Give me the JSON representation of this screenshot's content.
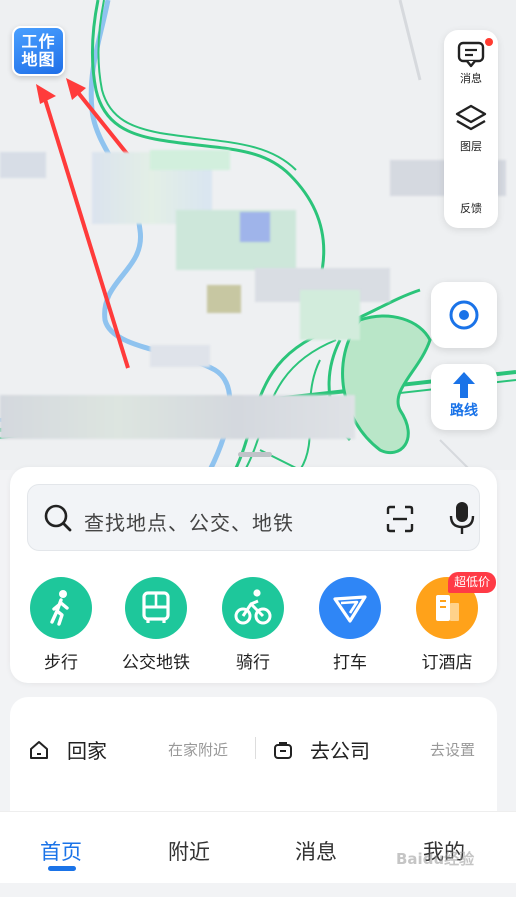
{
  "map": {
    "badge_line1": "工作",
    "badge_line2": "地图"
  },
  "right_panel": {
    "messages_label": "消息",
    "layers_label": "图层",
    "feedback_label": "反馈"
  },
  "route_button": {
    "label": "路线"
  },
  "search": {
    "placeholder": "查找地点、公交、地铁"
  },
  "quick_actions": [
    {
      "label": "步行",
      "color": "#1ec79b",
      "icon": "walk-icon"
    },
    {
      "label": "公交地铁",
      "color": "#1ec79b",
      "icon": "bus-icon"
    },
    {
      "label": "骑行",
      "color": "#1ec79b",
      "icon": "bike-icon"
    },
    {
      "label": "打车",
      "color": "#2f86f6",
      "icon": "taxi-icon"
    },
    {
      "label": "订酒店",
      "color": "#ffa21a",
      "icon": "hotel-icon"
    }
  ],
  "hotel_badge": "超低价",
  "shortcuts": {
    "home_label": "回家",
    "home_hint": "在家附近",
    "work_label": "去公司",
    "work_hint": "去设置"
  },
  "tabs": [
    {
      "label": "首页",
      "active": true
    },
    {
      "label": "附近",
      "active": false
    },
    {
      "label": "消息",
      "active": false
    },
    {
      "label": "我的",
      "active": false
    }
  ],
  "watermark": "Baidu经验",
  "colors": {
    "accent": "#1a73e8",
    "road_green": "#2bc47a",
    "road_blue": "#8fc3ef"
  }
}
